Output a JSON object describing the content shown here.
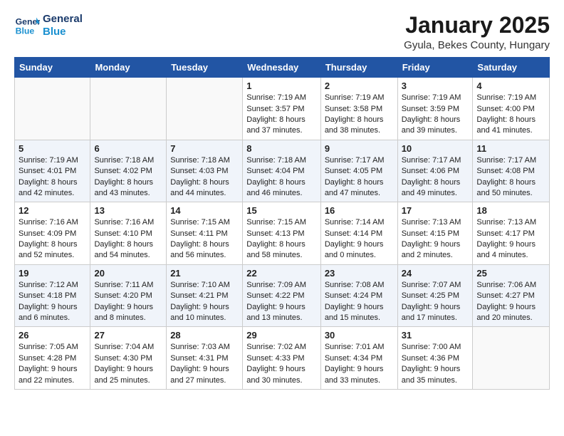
{
  "header": {
    "logo_line1": "General",
    "logo_line2": "Blue",
    "title": "January 2025",
    "subtitle": "Gyula, Bekes County, Hungary"
  },
  "weekdays": [
    "Sunday",
    "Monday",
    "Tuesday",
    "Wednesday",
    "Thursday",
    "Friday",
    "Saturday"
  ],
  "weeks": [
    [
      {
        "day": "",
        "info": ""
      },
      {
        "day": "",
        "info": ""
      },
      {
        "day": "",
        "info": ""
      },
      {
        "day": "1",
        "info": "Sunrise: 7:19 AM\nSunset: 3:57 PM\nDaylight: 8 hours and 37 minutes."
      },
      {
        "day": "2",
        "info": "Sunrise: 7:19 AM\nSunset: 3:58 PM\nDaylight: 8 hours and 38 minutes."
      },
      {
        "day": "3",
        "info": "Sunrise: 7:19 AM\nSunset: 3:59 PM\nDaylight: 8 hours and 39 minutes."
      },
      {
        "day": "4",
        "info": "Sunrise: 7:19 AM\nSunset: 4:00 PM\nDaylight: 8 hours and 41 minutes."
      }
    ],
    [
      {
        "day": "5",
        "info": "Sunrise: 7:19 AM\nSunset: 4:01 PM\nDaylight: 8 hours and 42 minutes."
      },
      {
        "day": "6",
        "info": "Sunrise: 7:18 AM\nSunset: 4:02 PM\nDaylight: 8 hours and 43 minutes."
      },
      {
        "day": "7",
        "info": "Sunrise: 7:18 AM\nSunset: 4:03 PM\nDaylight: 8 hours and 44 minutes."
      },
      {
        "day": "8",
        "info": "Sunrise: 7:18 AM\nSunset: 4:04 PM\nDaylight: 8 hours and 46 minutes."
      },
      {
        "day": "9",
        "info": "Sunrise: 7:17 AM\nSunset: 4:05 PM\nDaylight: 8 hours and 47 minutes."
      },
      {
        "day": "10",
        "info": "Sunrise: 7:17 AM\nSunset: 4:06 PM\nDaylight: 8 hours and 49 minutes."
      },
      {
        "day": "11",
        "info": "Sunrise: 7:17 AM\nSunset: 4:08 PM\nDaylight: 8 hours and 50 minutes."
      }
    ],
    [
      {
        "day": "12",
        "info": "Sunrise: 7:16 AM\nSunset: 4:09 PM\nDaylight: 8 hours and 52 minutes."
      },
      {
        "day": "13",
        "info": "Sunrise: 7:16 AM\nSunset: 4:10 PM\nDaylight: 8 hours and 54 minutes."
      },
      {
        "day": "14",
        "info": "Sunrise: 7:15 AM\nSunset: 4:11 PM\nDaylight: 8 hours and 56 minutes."
      },
      {
        "day": "15",
        "info": "Sunrise: 7:15 AM\nSunset: 4:13 PM\nDaylight: 8 hours and 58 minutes."
      },
      {
        "day": "16",
        "info": "Sunrise: 7:14 AM\nSunset: 4:14 PM\nDaylight: 9 hours and 0 minutes."
      },
      {
        "day": "17",
        "info": "Sunrise: 7:13 AM\nSunset: 4:15 PM\nDaylight: 9 hours and 2 minutes."
      },
      {
        "day": "18",
        "info": "Sunrise: 7:13 AM\nSunset: 4:17 PM\nDaylight: 9 hours and 4 minutes."
      }
    ],
    [
      {
        "day": "19",
        "info": "Sunrise: 7:12 AM\nSunset: 4:18 PM\nDaylight: 9 hours and 6 minutes."
      },
      {
        "day": "20",
        "info": "Sunrise: 7:11 AM\nSunset: 4:20 PM\nDaylight: 9 hours and 8 minutes."
      },
      {
        "day": "21",
        "info": "Sunrise: 7:10 AM\nSunset: 4:21 PM\nDaylight: 9 hours and 10 minutes."
      },
      {
        "day": "22",
        "info": "Sunrise: 7:09 AM\nSunset: 4:22 PM\nDaylight: 9 hours and 13 minutes."
      },
      {
        "day": "23",
        "info": "Sunrise: 7:08 AM\nSunset: 4:24 PM\nDaylight: 9 hours and 15 minutes."
      },
      {
        "day": "24",
        "info": "Sunrise: 7:07 AM\nSunset: 4:25 PM\nDaylight: 9 hours and 17 minutes."
      },
      {
        "day": "25",
        "info": "Sunrise: 7:06 AM\nSunset: 4:27 PM\nDaylight: 9 hours and 20 minutes."
      }
    ],
    [
      {
        "day": "26",
        "info": "Sunrise: 7:05 AM\nSunset: 4:28 PM\nDaylight: 9 hours and 22 minutes."
      },
      {
        "day": "27",
        "info": "Sunrise: 7:04 AM\nSunset: 4:30 PM\nDaylight: 9 hours and 25 minutes."
      },
      {
        "day": "28",
        "info": "Sunrise: 7:03 AM\nSunset: 4:31 PM\nDaylight: 9 hours and 27 minutes."
      },
      {
        "day": "29",
        "info": "Sunrise: 7:02 AM\nSunset: 4:33 PM\nDaylight: 9 hours and 30 minutes."
      },
      {
        "day": "30",
        "info": "Sunrise: 7:01 AM\nSunset: 4:34 PM\nDaylight: 9 hours and 33 minutes."
      },
      {
        "day": "31",
        "info": "Sunrise: 7:00 AM\nSunset: 4:36 PM\nDaylight: 9 hours and 35 minutes."
      },
      {
        "day": "",
        "info": ""
      }
    ]
  ]
}
